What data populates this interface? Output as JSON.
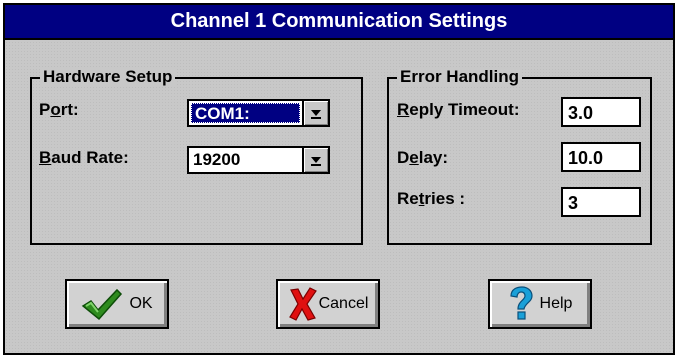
{
  "window": {
    "title": "Channel 1 Communication Settings"
  },
  "hardware": {
    "title": "Hardware Setup",
    "port_label_pre": "P",
    "port_label_ul": "o",
    "port_label_post": "rt:",
    "port_value": "COM1:",
    "baud_label_ul": "B",
    "baud_label_post": "aud Rate:",
    "baud_value": "19200"
  },
  "errors": {
    "title": "Error Handling",
    "reply_ul": "R",
    "reply_post": "eply Timeout:",
    "reply_value": "3.0",
    "delay_pre": "D",
    "delay_ul": "e",
    "delay_post": "lay:",
    "delay_value": "10.0",
    "retries_pre": "Re",
    "retries_ul": "t",
    "retries_post": "ries :",
    "retries_value": "3"
  },
  "buttons": {
    "ok": "OK",
    "cancel": "Cancel",
    "help": "Help"
  },
  "icons": {
    "dropdown": "dropdown-arrow-icon",
    "ok": "checkmark-icon",
    "cancel": "x-icon",
    "help": "question-mark-icon"
  }
}
